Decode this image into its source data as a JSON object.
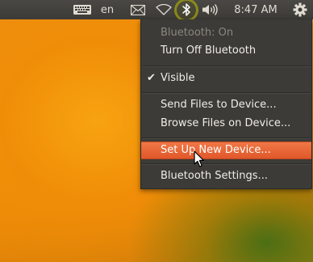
{
  "panel": {
    "keyboard_icon": "keyboard-icon",
    "language": "en",
    "mail_icon": "envelope-icon",
    "network_icon": "wifi-icon",
    "bluetooth_icon": "bluetooth-icon",
    "volume_icon": "speaker-volume-icon",
    "clock": "8:47 AM",
    "session_icon": "gear-power-icon",
    "highlight_color": "#8b8a1a"
  },
  "bluetooth_menu": {
    "status": "Bluetooth: On",
    "toggle_label": "Turn Off Bluetooth",
    "visible_label": "Visible",
    "visible_checked": true,
    "send_files_label": "Send Files to Device...",
    "browse_files_label": "Browse Files on Device...",
    "setup_label": "Set Up New Device...",
    "settings_label": "Bluetooth Settings...",
    "highlighted_item": "Set Up New Device...",
    "accent_color": "#e9622f"
  }
}
